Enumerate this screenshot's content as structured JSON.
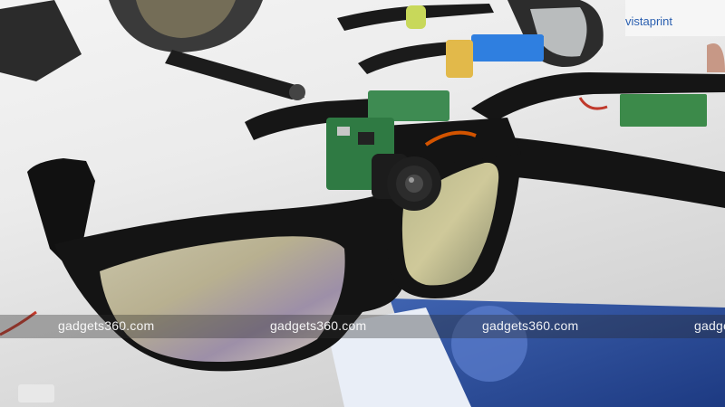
{
  "photo": {
    "watermark_text": "gadgets360.com",
    "brand_sign": "vistaprint"
  }
}
